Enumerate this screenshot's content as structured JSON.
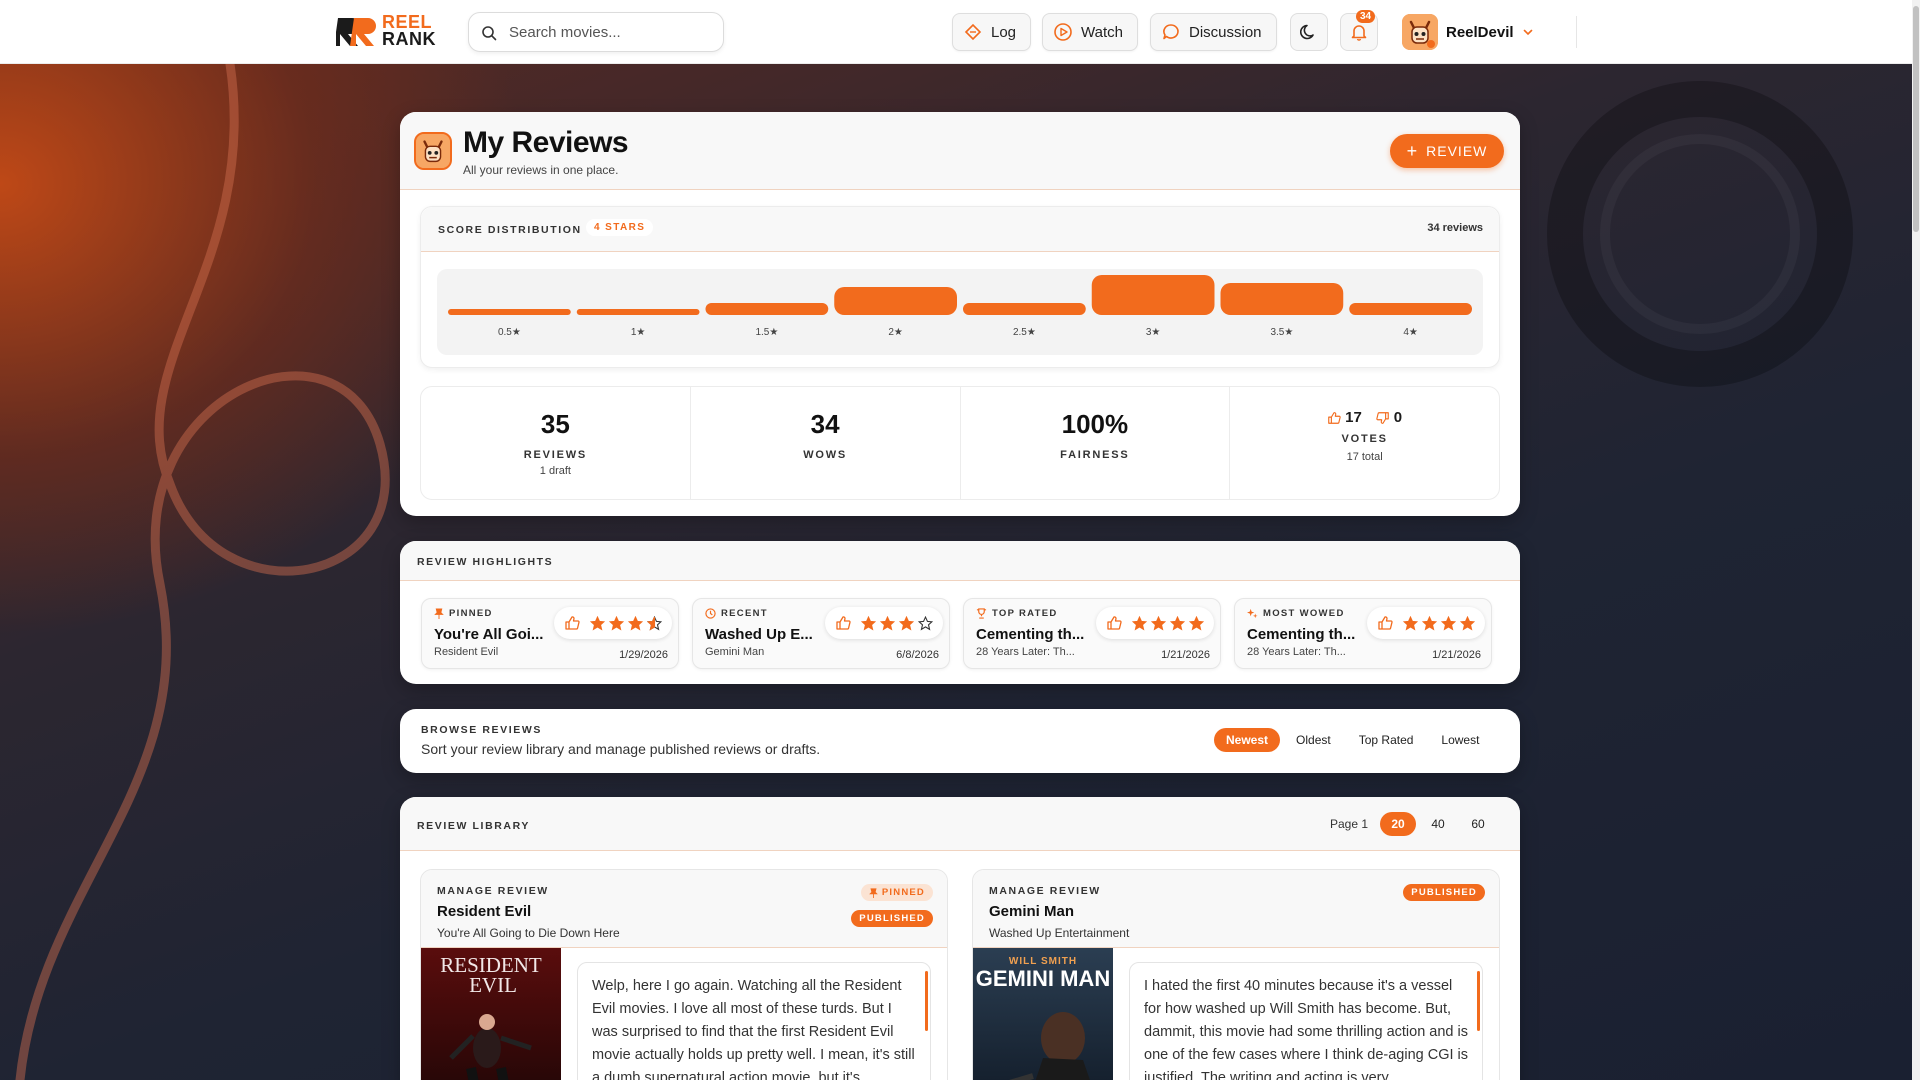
{
  "app": {
    "logo_line1": "REEL",
    "logo_line2": "RANK",
    "title": "Reel Rank"
  },
  "header": {
    "search_placeholder": "Search movies...",
    "log_label": "Log",
    "watch_label": "Watch",
    "discussion_label": "Discussion",
    "notification_count": "34",
    "username": "ReelDevil"
  },
  "page": {
    "title": "My Reviews",
    "subtitle": "All your reviews in one place.",
    "review_button": "REVIEW"
  },
  "distribution": {
    "label": "SCORE DISTRIBUTION",
    "filter_chip": "4 STARS",
    "count_text": "34 reviews"
  },
  "chart_data": {
    "type": "bar",
    "categories": [
      "0.5★",
      "1★",
      "1.5★",
      "2★",
      "2.5★",
      "3★",
      "3.5★",
      "4★"
    ],
    "values": [
      1,
      1,
      3,
      7,
      3,
      10,
      8,
      3
    ],
    "ylim": [
      0,
      10
    ],
    "grid": false
  },
  "stats": [
    {
      "value": "35",
      "label": "REVIEWS",
      "sub": "1 draft"
    },
    {
      "value": "34",
      "label": "WOWS",
      "sub": ""
    },
    {
      "value": "100%",
      "label": "FAIRNESS",
      "sub": ""
    }
  ],
  "votes": {
    "up": "17",
    "down": "0",
    "label": "VOTES",
    "sub": "17 total"
  },
  "highlights": {
    "label": "REVIEW HIGHLIGHTS",
    "items": [
      {
        "tag": "PINNED",
        "title": "You're All Goi...",
        "movie": "Resident Evil",
        "date": "1/29/2026",
        "rating": 3.5
      },
      {
        "tag": "RECENT",
        "title": "Washed Up E...",
        "movie": "Gemini Man",
        "date": "6/8/2026",
        "rating": 3
      },
      {
        "tag": "TOP RATED",
        "title": "Cementing th...",
        "movie": "28 Years Later: Th...",
        "date": "1/21/2026",
        "rating": 4.5
      },
      {
        "tag": "MOST WOWED",
        "title": "Cementing th...",
        "movie": "28 Years Later: Th...",
        "date": "1/21/2026",
        "rating": 4.5
      }
    ]
  },
  "browse": {
    "label": "BROWSE REVIEWS",
    "subtitle": "Sort your review library and manage published reviews or drafts.",
    "sort_options": [
      "Newest",
      "Oldest",
      "Top Rated",
      "Lowest"
    ],
    "active_sort": "Newest"
  },
  "library": {
    "label": "REVIEW LIBRARY",
    "page_label": "Page 1",
    "page_sizes": [
      "20",
      "40",
      "60"
    ],
    "active_size": "20",
    "cards": [
      {
        "eyebrow": "MANAGE REVIEW",
        "movie": "Resident Evil",
        "review_title": "You're All Going to Die Down Here",
        "badge_pinned": "PINNED",
        "badge_status": "PUBLISHED",
        "poster_text": "RESIDENT EVIL",
        "text": "Welp, here I go again. Watching all the Resident Evil movies. I love all most of these turds. But I was surprised to find that the first Resident Evil movie actually holds up pretty well. I mean, it's still a dumb supernatural action movie, but it's"
      },
      {
        "eyebrow": "MANAGE REVIEW",
        "movie": "Gemini Man",
        "review_title": "Washed Up Entertainment",
        "badge_status": "PUBLISHED",
        "poster_top": "WILL SMITH",
        "poster_text": "GEMINI MAN",
        "text": "I hated the first 40 minutes because it's a vessel for how washed up Will Smith has become. But, dammit, this movie had some thrilling action and is one of the few cases where I think de-aging CGI is justified. The writing and acting is very"
      }
    ]
  },
  "colors": {
    "accent": "#f26b1d",
    "accent_soft": "#fbe3d3"
  }
}
